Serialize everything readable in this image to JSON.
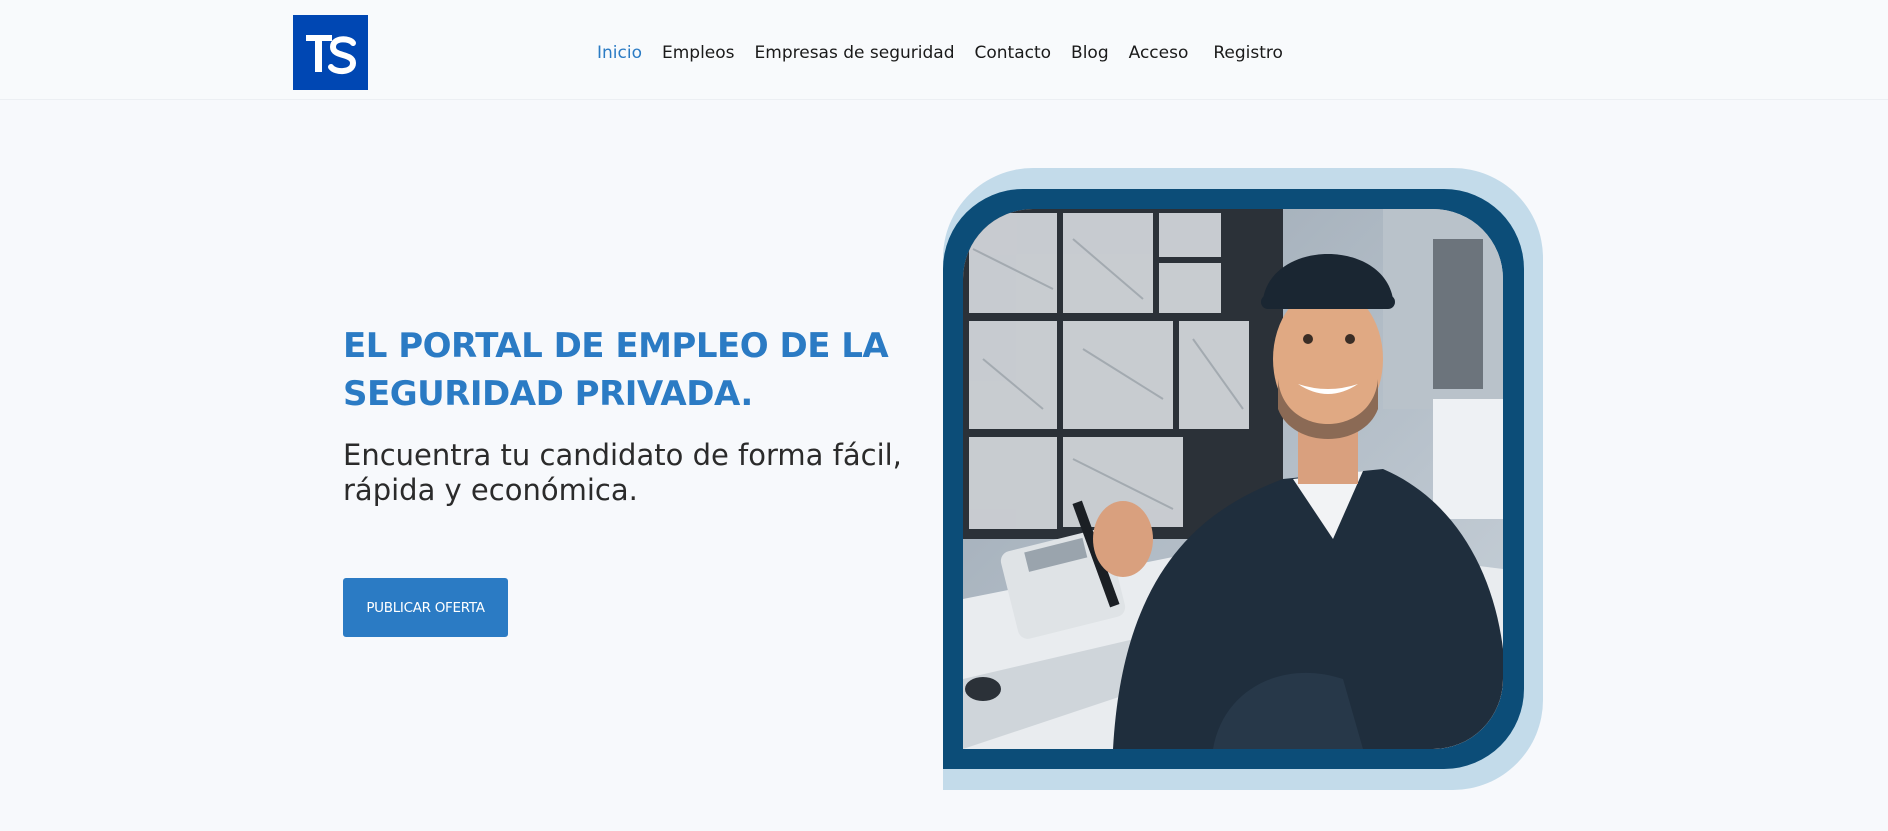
{
  "header": {
    "logo": {
      "text": "TS",
      "color": "#0047b3"
    },
    "nav": [
      {
        "label": "Inicio",
        "active": true
      },
      {
        "label": "Empleos"
      },
      {
        "label": "Empresas de seguridad"
      },
      {
        "label": "Contacto"
      },
      {
        "label": "Blog"
      },
      {
        "label": "Acceso"
      },
      {
        "label": "Registro"
      }
    ]
  },
  "hero": {
    "title": "EL PORTAL DE EMPLEO DE LA SEGURIDAD PRIVADA.",
    "subtitle": "Encuentra tu candidato de forma fácil, rápida y económica.",
    "cta_label": "PUBLICAR OFERTA",
    "image": {
      "subject": "security guard smiling at monitoring desk"
    }
  },
  "colors": {
    "accent": "#2b7bc4",
    "logo_bg": "#0047b3",
    "frame_light": "#c3dbea",
    "frame_dark": "#0c4d78",
    "background": "#f7f9fc"
  }
}
